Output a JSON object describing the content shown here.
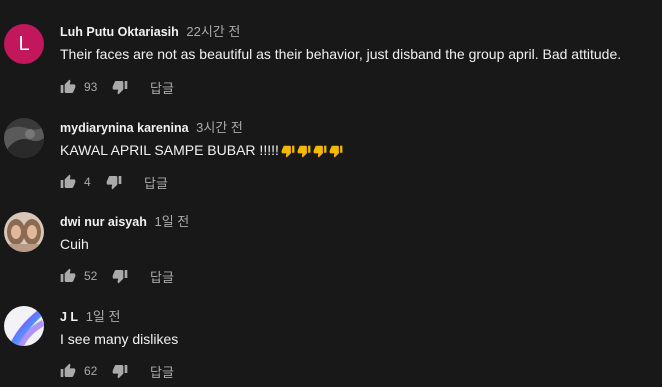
{
  "comments": [
    {
      "author": "Luh Putu Oktariasih",
      "time": "22시간 전",
      "text": "Their faces are not as beautiful as their behavior, just disband the group april. Bad attitude.",
      "likes": "93",
      "reply_label": "답글",
      "avatar_letter": "L"
    },
    {
      "author": "mydiarynina karenina",
      "time": "3시간 전",
      "text": "KAWAL APRIL SAMPE BUBAR !!!!!",
      "emoji": [
        "thumbs-down-emoji",
        "thumbs-down-emoji",
        "thumbs-down-emoji",
        "thumbs-down-emoji"
      ],
      "likes": "4",
      "reply_label": "답글"
    },
    {
      "author": "dwi nur aisyah",
      "time": "1일 전",
      "text": "Cuih",
      "likes": "52",
      "reply_label": "답글"
    },
    {
      "author": "J L",
      "time": "1일 전",
      "text": "I see many dislikes",
      "likes": "62",
      "reply_label": "답글"
    }
  ],
  "colors": {
    "background": "#181818",
    "text_primary": "#f1f1f1",
    "text_secondary": "#aaaaaa",
    "avatar_l": "#c2185b",
    "emoji": "#f5b800"
  }
}
